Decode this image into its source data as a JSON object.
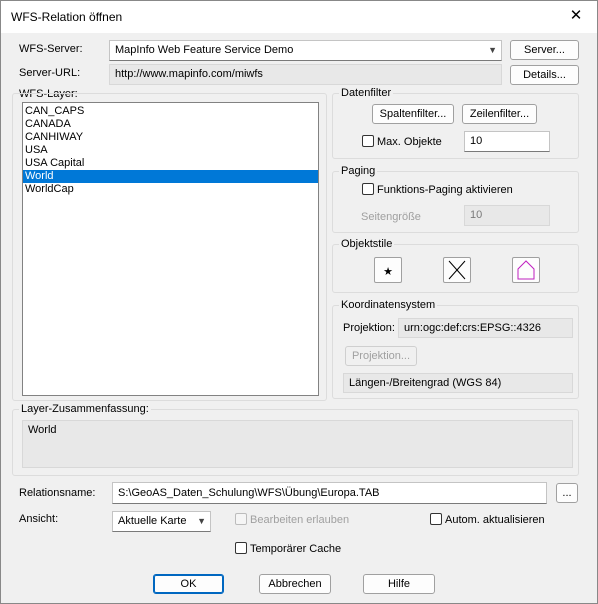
{
  "window": {
    "title": "WFS-Relation öffnen",
    "close_glyph": "✕"
  },
  "server": {
    "label": "WFS-Server:",
    "value": "MapInfo Web Feature Service Demo",
    "button": "Server...",
    "url_label": "Server-URL:",
    "url_value": "http://www.mapinfo.com/miwfs",
    "details_button": "Details..."
  },
  "layers": {
    "label": "WFS-Layer:",
    "items": [
      "CAN_CAPS",
      "CANADA",
      "CANHIWAY",
      "USA",
      "USA Capital",
      "World",
      "WorldCap"
    ],
    "selected": "World"
  },
  "datenfilter": {
    "title": "Datenfilter",
    "spalten_button": "Spaltenfilter...",
    "zeilen_button": "Zeilenfilter...",
    "max_label": "Max. Objekte",
    "max_value": "10"
  },
  "paging": {
    "title": "Paging",
    "checkbox_label": "Funktions-Paging aktivieren",
    "page_size_label": "Seitengröße",
    "page_size_value": "10"
  },
  "objektstile": {
    "title": "Objektstile",
    "icons": [
      "point-style-icon",
      "line-style-icon",
      "region-style-icon"
    ],
    "region_color": "#c020c0"
  },
  "koordinatensystem": {
    "title": "Koordinatensystem",
    "projektion_label": "Projektion:",
    "projektion_value": "urn:ogc:def:crs:EPSG::4326",
    "projektion_button": "Projektion...",
    "description": "Längen-/Breitengrad (WGS 84)"
  },
  "summary": {
    "label": "Layer-Zusammenfassung:",
    "text": "World"
  },
  "relation": {
    "label": "Relationsname:",
    "value": "S:\\GeoAS_Daten_Schulung\\WFS\\Übung\\Europa.TAB",
    "browse_button": "..."
  },
  "ansicht": {
    "label": "Ansicht:",
    "value": "Aktuelle Karte",
    "bearbeiten_label": "Bearbeiten erlauben",
    "autom_label": "Autom. aktualisieren",
    "cache_label": "Temporärer Cache"
  },
  "footer": {
    "ok": "OK",
    "cancel": "Abbrechen",
    "help": "Hilfe"
  },
  "colors": {
    "accent": "#0078d7",
    "default_button_border": "#0067c0"
  }
}
